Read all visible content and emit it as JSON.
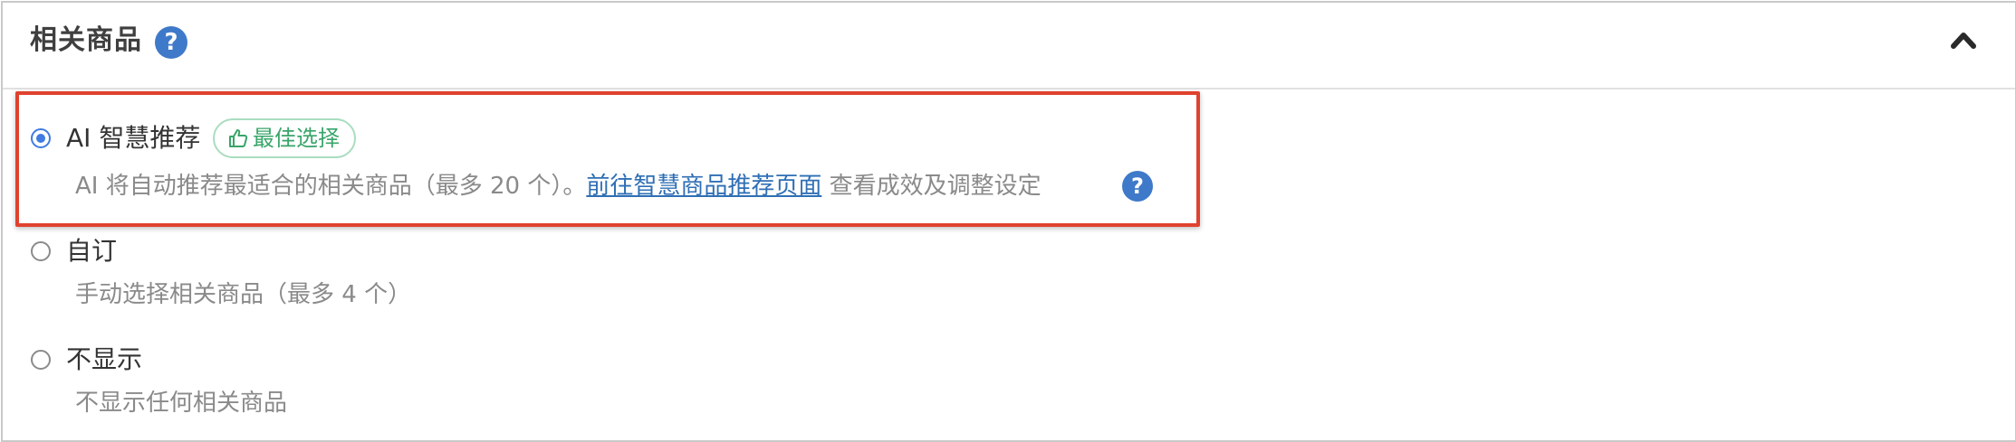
{
  "section": {
    "title": "相关商品",
    "help_icon": "question-circle-icon",
    "collapse_icon": "chevron-up-icon"
  },
  "options": [
    {
      "label": "AI 智慧推荐",
      "selected": true,
      "badge": "最佳选择",
      "badge_icon": "thumbs-up-icon",
      "desc_prefix": "AI 将自动推荐最适合的相关商品（最多 20 个）。",
      "link_text": "前往智慧商品推荐页面",
      "desc_suffix": "查看成效及调整设定"
    },
    {
      "label": "自订",
      "selected": false,
      "desc": "手动选择相关商品（最多 4 个）"
    },
    {
      "label": "不显示",
      "selected": false,
      "desc": "不显示任何相关商品"
    }
  ],
  "colors": {
    "accent": "#3f7be0",
    "help": "#3f79c9",
    "highlight": "#e0422f",
    "badge": "#38a56a"
  }
}
